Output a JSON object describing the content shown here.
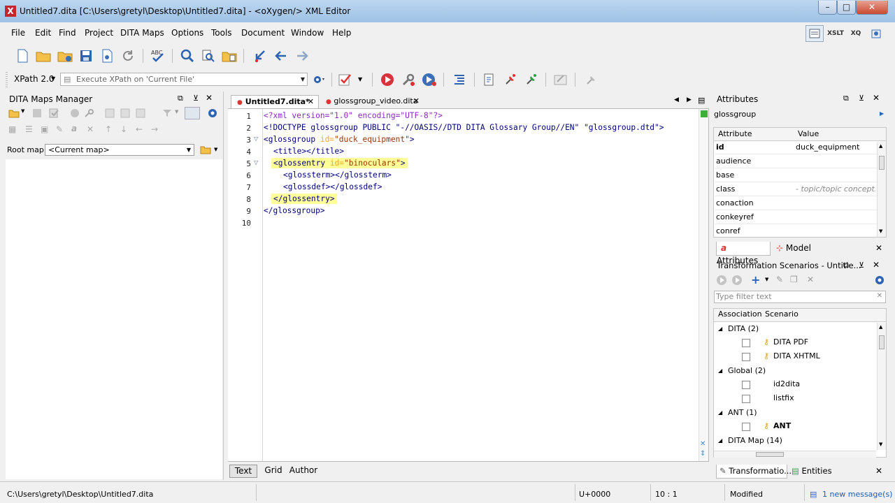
{
  "window": {
    "title": "Untitled7.dita [C:\\Users\\gretyl\\Desktop\\Untitled7.dita] - <oXygen/> XML Editor",
    "min": "–",
    "max": "□",
    "close": "✕"
  },
  "menu": [
    "File",
    "Edit",
    "Find",
    "Project",
    "DITA Maps",
    "Options",
    "Tools",
    "Document",
    "Window",
    "Help"
  ],
  "perspective_buttons": [
    "XSLT",
    "XQ"
  ],
  "xpath": {
    "version": "XPath 2.0",
    "placeholder": "Execute XPath on  'Current File'"
  },
  "left_panel": {
    "title": "DITA Maps Manager",
    "root_map_label": "Root map:",
    "root_map_value": "<Current map>"
  },
  "editor": {
    "tabs": [
      {
        "label": "Untitled7.dita*",
        "active": true
      },
      {
        "label": "glossgroup_video.dita",
        "active": false
      }
    ],
    "line_numbers": [
      "1",
      "2",
      "3",
      "4",
      "5",
      "6",
      "7",
      "8",
      "9",
      "10"
    ],
    "lines": {
      "l1": "<?xml version=\"1.0\" encoding=\"UTF-8\"?>",
      "l2": "<!DOCTYPE glossgroup PUBLIC \"-//OASIS//DTD DITA Glossary Group//EN\" \"glossgroup.dtd\">",
      "l3_open": "<glossgroup",
      "l3_attr": " id=",
      "l3_val": "\"duck_equipment\"",
      "l3_close": ">",
      "l4": "<title></title>",
      "l5_open": "<glossentry",
      "l5_attr": " id=",
      "l5_val": "\"binoculars\"",
      "l5_close": ">",
      "l6": "<glossterm></glossterm>",
      "l7": "<glossdef></glossdef>",
      "l8": "</glossentry>",
      "l9": "</glossgroup>"
    },
    "mode_tabs": [
      "Text",
      "Grid",
      "Author"
    ]
  },
  "attributes_panel": {
    "title": "Attributes",
    "element": "glossgroup",
    "col_attribute": "Attribute",
    "col_value": "Value",
    "rows": [
      {
        "name": "id",
        "value": "duck_equipment",
        "bold": true
      },
      {
        "name": "audience",
        "value": ""
      },
      {
        "name": "base",
        "value": ""
      },
      {
        "name": "class",
        "value": "- topic/topic concept..."
      },
      {
        "name": "conaction",
        "value": ""
      },
      {
        "name": "conkeyref",
        "value": ""
      },
      {
        "name": "conref",
        "value": ""
      }
    ],
    "tabs": [
      "Attributes",
      "Model"
    ]
  },
  "scenarios_panel": {
    "title": "Transformation Scenarios - Untitle...",
    "filter_placeholder": "Type filter text",
    "col_association": "Association",
    "col_scenario": "Scenario",
    "groups": {
      "dita": "DITA (2)",
      "dita_pdf": "DITA PDF",
      "dita_xhtml": "DITA XHTML",
      "global": "Global (2)",
      "id2dita": "id2dita",
      "listfix": "listfix",
      "ant": "ANT (1)",
      "ant_item": "ANT",
      "ditamap": "DITA Map (14)"
    },
    "bottom_tabs": [
      "Transformatio...",
      "Entities"
    ]
  },
  "status": {
    "path": "C:\\Users\\gretyl\\Desktop\\Untitled7.dita",
    "unicode": "U+0000",
    "position": "10 : 1",
    "modified": "Modified",
    "messages": "1 new message(s)"
  },
  "colors": {
    "accent_blue": "#1e5fb4",
    "tag": "#000080",
    "attr": "#f5a623",
    "value": "#993300",
    "highlight": "#ffff99"
  }
}
